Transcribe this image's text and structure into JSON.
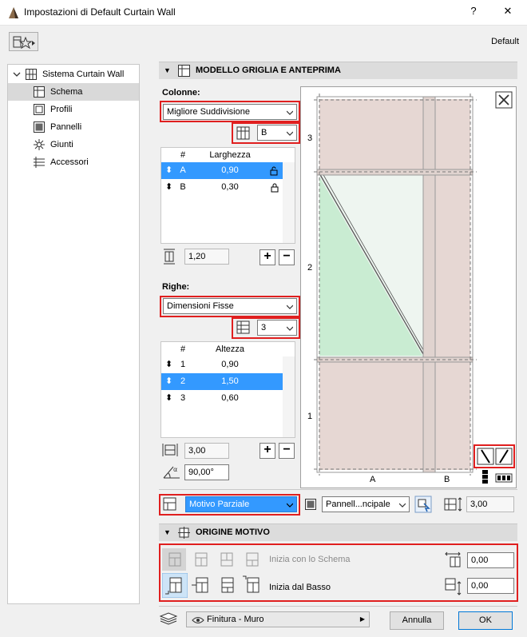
{
  "window": {
    "title": "Impostazioni di Default Curtain Wall",
    "help": "?",
    "close": "✕",
    "profile": "Default"
  },
  "tree": {
    "root": "Sistema Curtain Wall",
    "items": [
      "Schema",
      "Profili",
      "Pannelli",
      "Giunti",
      "Accessori"
    ]
  },
  "grid_section": {
    "title": "MODELLO GRIGLIA E ANTEPRIMA",
    "columns": {
      "label": "Colonne:",
      "mode": "Migliore Suddivisione",
      "selector": "B",
      "header_num": "#",
      "header_val": "Larghezza",
      "rows": [
        {
          "id": "A",
          "value": "0,90"
        },
        {
          "id": "B",
          "value": "0,30"
        }
      ],
      "total": "1,20"
    },
    "rows": {
      "label": "Righe:",
      "mode": "Dimensioni Fisse",
      "selector": "3",
      "header_num": "#",
      "header_val": "Altezza",
      "rows": [
        {
          "id": "1",
          "value": "0,90"
        },
        {
          "id": "2",
          "value": "1,50"
        },
        {
          "id": "3",
          "value": "0,60"
        }
      ],
      "total": "3,00",
      "angle": "90,00°"
    },
    "preview": {
      "row_labels": [
        "3",
        "2",
        "1"
      ],
      "col_labels": [
        "A",
        "B"
      ]
    },
    "pattern": "Motivo Parziale",
    "panel_type": "Pannell...ncipale",
    "height": "3,00"
  },
  "origin_section": {
    "title": "ORIGINE MOTIVO",
    "start_schema": "Inizia con lo Schema",
    "start_bottom": "Inizia dal Basso",
    "offset_x": "0,00",
    "offset_y": "0,00"
  },
  "footer": {
    "layer": "Finitura - Muro",
    "cancel": "Annulla",
    "ok": "OK"
  },
  "colors": {
    "selection": "#3399ff",
    "highlight": "#e01f1f",
    "panel_fill": "#e6d7d3",
    "glass_fill": "#c9ecd2"
  }
}
